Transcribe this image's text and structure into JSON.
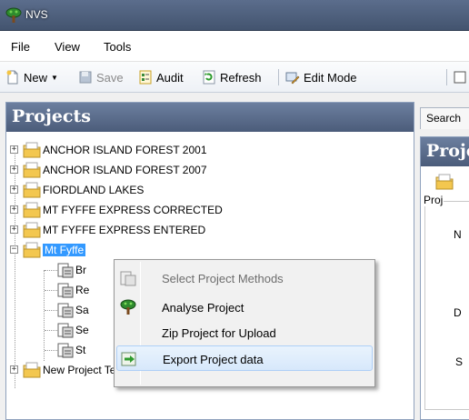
{
  "window": {
    "title": "NVS"
  },
  "menubar": {
    "items": [
      "File",
      "View",
      "Tools"
    ]
  },
  "toolbar": {
    "new_label": "New",
    "save_label": "Save",
    "audit_label": "Audit",
    "refresh_label": "Refresh",
    "edit_mode_label": "Edit Mode"
  },
  "projects_panel": {
    "title": "Projects",
    "tree": [
      {
        "label": "ANCHOR ISLAND FOREST 2001",
        "expander": "+"
      },
      {
        "label": "ANCHOR ISLAND FOREST 2007",
        "expander": "+"
      },
      {
        "label": "FIORDLAND LAKES",
        "expander": "+"
      },
      {
        "label": "MT FYFFE EXPRESS CORRECTED",
        "expander": "+"
      },
      {
        "label": "MT FYFFE EXPRESS ENTERED",
        "expander": "+"
      },
      {
        "label": "Mt Fyffe",
        "expander": "−",
        "selected": true
      },
      {
        "label": "Br",
        "child": true
      },
      {
        "label": "Re",
        "child": true
      },
      {
        "label": "Sa",
        "child": true
      },
      {
        "label": "Se",
        "child": true
      },
      {
        "label": "St",
        "child": true
      },
      {
        "label": "New Project Testing NVS Exp",
        "expander": "+"
      }
    ]
  },
  "right_pane": {
    "search_tab": "Search",
    "project_title": "Project",
    "group_label": "Proj",
    "field_letters": [
      "N",
      "D",
      "S"
    ]
  },
  "context_menu": {
    "items": [
      {
        "label": "Select Project Methods",
        "icon": "methods-icon",
        "disabled": true
      },
      {
        "label": "Analyse Project",
        "icon": "tree-icon",
        "disabled": false
      },
      {
        "label": "Zip Project for Upload",
        "icon": "",
        "disabled": false
      },
      {
        "label": "Export Project data",
        "icon": "export-icon",
        "disabled": false,
        "hover": true
      }
    ]
  },
  "colors": {
    "panel_header": "#4b5c7a",
    "selection": "#3399ff",
    "menu_hover": "#d7e8fb"
  }
}
